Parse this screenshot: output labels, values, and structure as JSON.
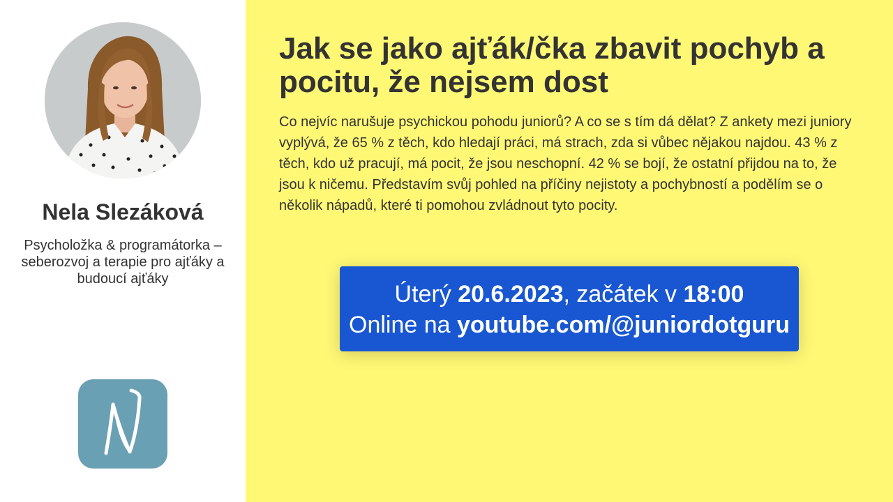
{
  "speaker": {
    "name": "Nela Slezáková",
    "bio": "Psycholožka & programátorka – seberozvoj a terapie pro ajťáky a budoucí ajťáky",
    "avatar_icon": "speaker-photo",
    "logo_icon": "letter-n-logo",
    "logo_color": "#6aa0b3"
  },
  "talk": {
    "title": "Jak se jako ajťák/čka zbavit pochyb a pocitu, že nejsem dost",
    "description": "Co nejvíc narušuje psychickou pohodu juniorů? A co se s tím dá dělat? Z ankety mezi juniory vyplývá, že 65 % z těch, kdo hledají práci, má strach, zda si vůbec nějakou najdou. 43 % z těch, kdo už pracují, má pocit, že jsou neschopní. 42 % se bojí, že ostatní přijdou na to, že jsou k ničemu. Představím svůj pohled na příčiny nejistoty a pochybností a podělím se o několik nápadů, které ti pomohou zvládnout tyto pocity."
  },
  "event": {
    "day_label": "Úterý ",
    "date": "20.6.2023",
    "start_label": ", začátek v ",
    "time": "18:00",
    "online_label": "Online na ",
    "url": "youtube.com/@juniordotguru"
  },
  "colors": {
    "main_background": "#fff875",
    "sidebar_background": "#ffffff",
    "event_box": "#1957d2",
    "text": "#333333"
  }
}
